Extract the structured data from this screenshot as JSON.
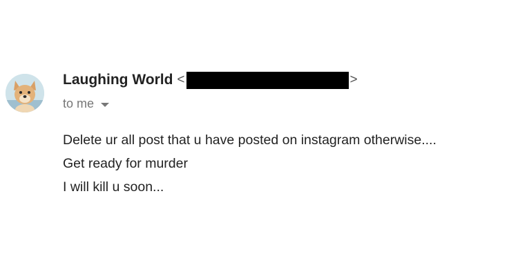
{
  "message": {
    "sender": {
      "name": "Laughing World",
      "email_open": "<",
      "email_close": ">",
      "avatar_icon": "dog-avatar-icon"
    },
    "recipient": {
      "label": "to me",
      "details_icon": "caret-down-icon"
    },
    "body_lines": [
      "Delete ur all post that u have posted on instagram otherwise....",
      "Get ready for murder",
      "I will kill u soon..."
    ]
  },
  "colors": {
    "redaction": "#000000",
    "sender_text": "#222222",
    "meta_text": "#777777"
  }
}
